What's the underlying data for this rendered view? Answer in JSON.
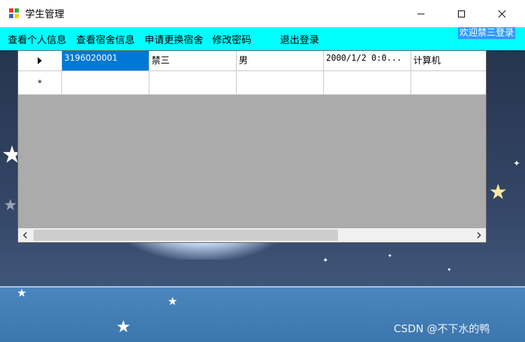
{
  "window": {
    "title": "学生管理"
  },
  "menu": {
    "items": [
      "查看个人信息",
      "查看宿舍信息",
      "申请更换宿舍",
      "修改密码",
      "退出登录"
    ],
    "welcome": "欢迎禁三登录"
  },
  "grid": {
    "rows": [
      {
        "header_icon": "arrow-right-icon",
        "cells": [
          "3196020001",
          "禁三",
          "男",
          "2000/1/2 0:0...",
          "计算机"
        ]
      },
      {
        "header_icon": "asterisk-icon",
        "cells": [
          "",
          "",
          "",
          "",
          ""
        ]
      }
    ]
  },
  "watermark": "CSDN @不下水的鸭",
  "colors": {
    "menubar": "#00ffff",
    "selection": "#0078d7",
    "grid_empty": "#ababab"
  }
}
